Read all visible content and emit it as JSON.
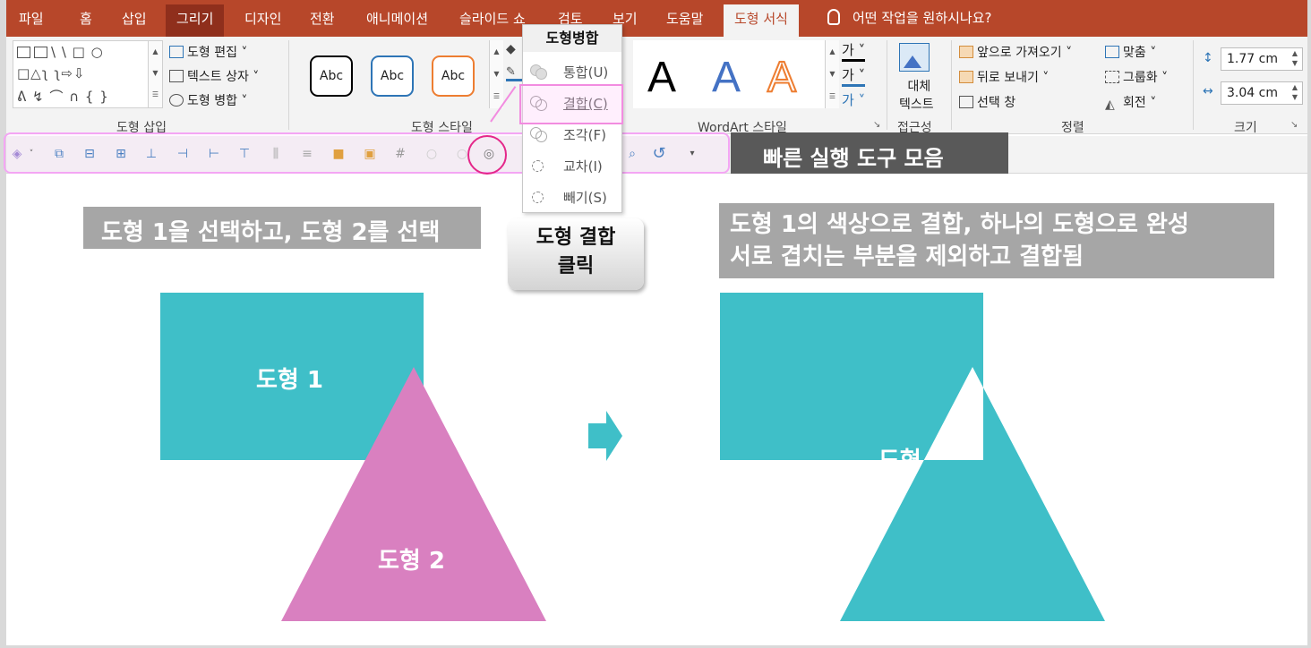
{
  "tabs": [
    {
      "label": "파일"
    },
    {
      "label": "홈"
    },
    {
      "label": "삽입"
    },
    {
      "label": "그리기"
    },
    {
      "label": "디자인"
    },
    {
      "label": "전환"
    },
    {
      "label": "애니메이션"
    },
    {
      "label": "슬라이드 쇼"
    },
    {
      "label": "검토"
    },
    {
      "label": "보기"
    },
    {
      "label": "도움말"
    },
    {
      "label": "도형 서식"
    }
  ],
  "tell_me": "어떤 작업을 원하시나요?",
  "ribbon": {
    "insert_shapes": {
      "label": "도형 삽입",
      "edit_shape": "도형 편집",
      "text_box": "텍스트 상자",
      "merge_shapes": "도형 병합",
      "shape_glyphs_row1": "\\ \\ □ ○",
      "shape_glyphs_row2": "□△ʅ ʅ⇨⇩",
      "shape_glyphs_row3": "ᕕ ↯ ⌒ ∩ { }"
    },
    "shape_styles": {
      "label": "도형 스타일",
      "samples": [
        "Abc",
        "Abc",
        "Abc"
      ]
    },
    "wordart": {
      "label": "WordArt 스타일",
      "samples": [
        "A",
        "A",
        "A"
      ]
    },
    "accessibility": {
      "label": "접근성",
      "alt_text_line1": "대체",
      "alt_text_line2": "텍스트"
    },
    "arrange": {
      "label": "정렬",
      "bring_forward": "앞으로 가져오기",
      "send_backward": "뒤로 보내기",
      "selection_pane": "선택 창",
      "align": "맞춤",
      "group": "그룹화",
      "rotate": "회전"
    },
    "size": {
      "label": "크기",
      "height": "1.77 cm",
      "width": "3.04 cm"
    }
  },
  "merge_menu": {
    "title": "도형병합",
    "items": [
      {
        "label": "통합(U)"
      },
      {
        "label": "결합(C)"
      },
      {
        "label": "조각(F)"
      },
      {
        "label": "교차(I)"
      },
      {
        "label": "빼기(S)"
      }
    ]
  },
  "qat_label": "빠른 실행 도구 모음",
  "caption_left": "도형 1을 선택하고, 도형 2를 선택",
  "callout_line1": "도형 결합",
  "callout_line2": "클릭",
  "caption_right_line1": "도형 1의 색상으로 결합, 하나의 도형으로 완성",
  "caption_right_line2": "서로 겹치는 부분을 제외하고 결합됨",
  "shape1_label": "도형 1",
  "shape2_label": "도형 2",
  "result_label": "도형 1",
  "colors": {
    "tab_bar": "#b7472a",
    "teal": "#3fbfc8",
    "pink": "#d980c0",
    "caption_gray": "#a6a6a6",
    "qat_label_bg": "#595959",
    "highlight_pink": "#f28ce0"
  }
}
